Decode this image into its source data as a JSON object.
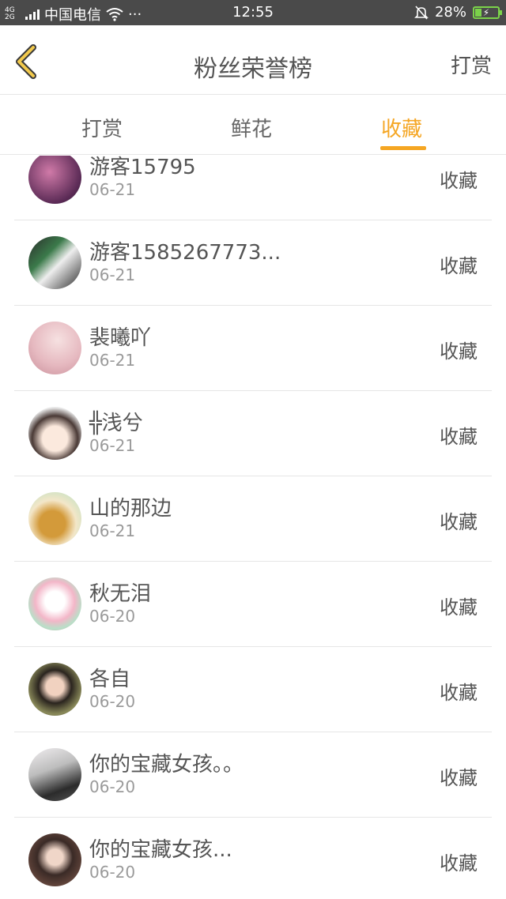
{
  "status_bar": {
    "network": "4G\n2G",
    "carrier": "中国电信",
    "more": "···",
    "time": "12:55",
    "battery": "28%",
    "battery_level": 0.28,
    "accent": "#7bd34a"
  },
  "navbar": {
    "title": "粉丝荣誉榜",
    "action": "打赏",
    "back_color": "#f5a623"
  },
  "tabs": [
    {
      "label": "打赏",
      "active": false
    },
    {
      "label": "鲜花",
      "active": false
    },
    {
      "label": "收藏",
      "active": true
    }
  ],
  "colors": {
    "accent": "#f5a623"
  },
  "list": [
    {
      "name": "游客15795",
      "date": "06-21",
      "action": "收藏",
      "avatar": "avatar-1"
    },
    {
      "name": "游客1585267773...",
      "date": "06-21",
      "action": "收藏",
      "avatar": "avatar-2"
    },
    {
      "name": "裴曦吖",
      "date": "06-21",
      "action": "收藏",
      "avatar": "avatar-3"
    },
    {
      "name": "╬浅兮",
      "date": "06-21",
      "action": "收藏",
      "avatar": "avatar-4"
    },
    {
      "name": "山的那边",
      "date": "06-21",
      "action": "收藏",
      "avatar": "avatar-5"
    },
    {
      "name": "秋无泪",
      "date": "06-20",
      "action": "收藏",
      "avatar": "avatar-6"
    },
    {
      "name": "各自",
      "date": "06-20",
      "action": "收藏",
      "avatar": "avatar-7"
    },
    {
      "name": "你的宝藏女孩。。",
      "date": "06-20",
      "action": "收藏",
      "avatar": "avatar-8"
    },
    {
      "name": "你的宝藏女孩...",
      "date": "06-20",
      "action": "收藏",
      "avatar": "avatar-9"
    }
  ]
}
